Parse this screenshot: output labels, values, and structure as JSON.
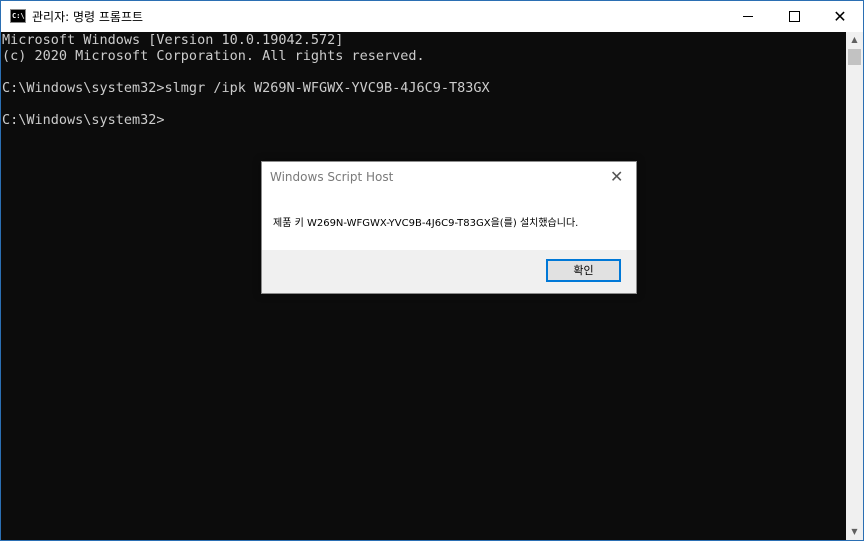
{
  "window": {
    "title": "관리자: 명령 프롬프트",
    "icon": "cmd-icon",
    "app_icon_text": "C:\\"
  },
  "controls": {
    "minimize": "minimize-icon",
    "maximize": "maximize-icon",
    "close": "close-icon",
    "close_glyph": "✕"
  },
  "console": {
    "lines": [
      "Microsoft Windows [Version 10.0.19042.572]",
      "(c) 2020 Microsoft Corporation. All rights reserved.",
      "C:\\Windows\\system32>slmgr /ipk W269N-WFGWX-YVC9B-4J6C9-T83GX",
      "C:\\Windows\\system32>"
    ]
  },
  "scrollbar": {
    "up_arrow": "▲",
    "down_arrow": "▼"
  },
  "dialog": {
    "title": "Windows Script Host",
    "close_glyph": "✕",
    "message": "제품 키 W269N-WFGWX-YVC9B-4J6C9-T83GX을(를) 설치했습니다.",
    "ok_label": "확인"
  },
  "colors": {
    "console_bg": "#0c0c0c",
    "console_fg": "#cccccc",
    "accent": "#0078d7"
  }
}
